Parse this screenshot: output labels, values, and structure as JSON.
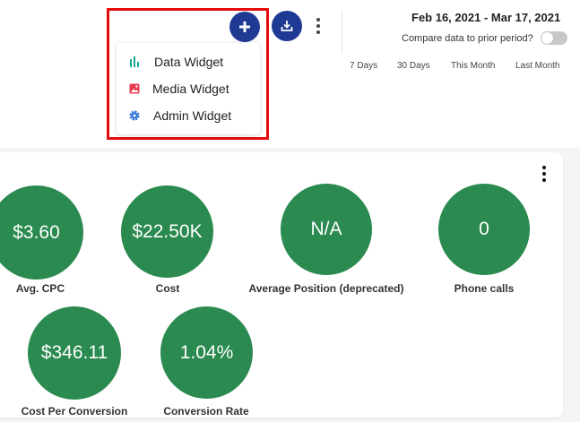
{
  "toolbar": {
    "add_icon": "plus-icon",
    "download_icon": "download-icon",
    "more_icon": "kebab-icon",
    "accent_color": "#1f3a93"
  },
  "add_menu": {
    "items": [
      {
        "label": "Data Widget",
        "icon": "bar-chart-icon",
        "color": "#1aa89a"
      },
      {
        "label": "Media Widget",
        "icon": "image-icon",
        "color": "#e53950"
      },
      {
        "label": "Admin Widget",
        "icon": "gear-icon",
        "color": "#2b6fd6"
      }
    ],
    "highlight_color": "#e30d0d"
  },
  "date_panel": {
    "range": "Feb 16, 2021 - Mar 17, 2021",
    "compare_label": "Compare data to prior period?",
    "compare_enabled": false,
    "periods": [
      "7 Days",
      "30 Days",
      "This Month",
      "Last Month"
    ]
  },
  "metrics_card": {
    "circle_color": "#2a8a4f",
    "metrics": [
      {
        "value": "$3.60",
        "label": "Avg. CPC"
      },
      {
        "value": "$22.50K",
        "label": "Cost"
      },
      {
        "value": "N/A",
        "label": "Average Position (deprecated)"
      },
      {
        "value": "0",
        "label": "Phone calls"
      },
      {
        "value": "$346.11",
        "label": "Cost Per Conversion"
      },
      {
        "value": "1.04%",
        "label": "Conversion Rate"
      }
    ]
  }
}
